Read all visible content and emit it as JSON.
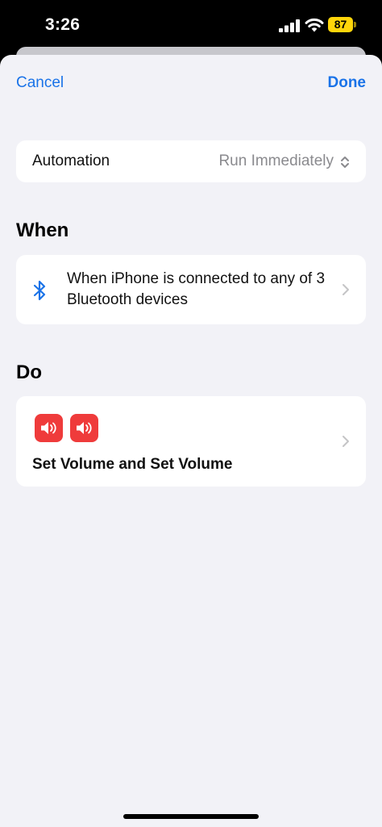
{
  "status_bar": {
    "time": "3:26",
    "battery_level": "87",
    "battery_color": "#ffd60a"
  },
  "nav": {
    "cancel_label": "Cancel",
    "done_label": "Done",
    "accent_color": "#1a73e8"
  },
  "automation": {
    "label": "Automation",
    "value": "Run Immediately",
    "icon": "chevron-up-down-icon"
  },
  "when": {
    "title": "When",
    "trigger_text": "When iPhone is connected to any of 3 Bluetooth devices",
    "icon": "bluetooth-icon"
  },
  "do": {
    "title": "Do",
    "actions_text": "Set Volume and Set Volume",
    "action_icons": [
      "volume-icon",
      "volume-icon"
    ],
    "action_icon_color": "#ef3b3b"
  }
}
